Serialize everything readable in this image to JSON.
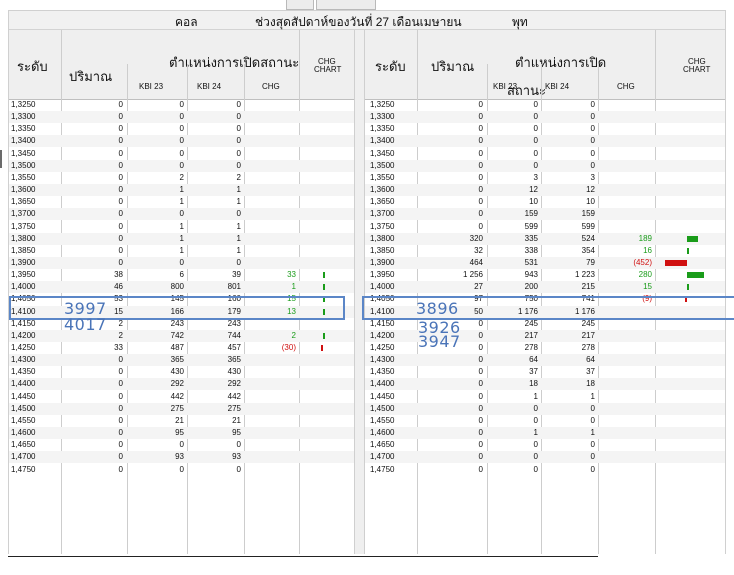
{
  "header": {
    "call": "คอล",
    "title": "ช่วงสุดสัปดาห์ของวันที่ 27 เดือนเมษายน",
    "put": "พุท"
  },
  "columns": {
    "level": "ระดับ",
    "volume": "ปริมาณ",
    "oi_call": "ตำแหน่งการเปิดสถานะ",
    "oi_put_line1": "ตำแหน่งการเปิด",
    "oi_put_line2": "สถานะ",
    "kbi23": "KBI 23",
    "kbi24": "KBI 24",
    "chg": "CHG",
    "chg_chart_1": "CHG",
    "chg_chart_2": "CHART"
  },
  "colors": {
    "positive": "#1a9c1a",
    "negative": "#d01010",
    "highlight": "#5b86c7"
  },
  "annotations": {
    "left_1": "3997",
    "left_2": "4017",
    "right_1": "3896",
    "right_2": "3926",
    "right_3": "3947"
  },
  "rows": [
    {
      "level": "1,3250",
      "c_vol": "0",
      "c_k23": "0",
      "c_k24": "0",
      "c_chg": "",
      "c_bar": 0,
      "p_vol": "0",
      "p_k23": "0",
      "p_k24": "0",
      "p_chg": "",
      "p_bar": 0
    },
    {
      "level": "1,3300",
      "c_vol": "0",
      "c_k23": "0",
      "c_k24": "0",
      "c_chg": "",
      "c_bar": 0,
      "p_vol": "0",
      "p_k23": "0",
      "p_k24": "0",
      "p_chg": "",
      "p_bar": 0
    },
    {
      "level": "1,3350",
      "c_vol": "0",
      "c_k23": "0",
      "c_k24": "0",
      "c_chg": "",
      "c_bar": 0,
      "p_vol": "0",
      "p_k23": "0",
      "p_k24": "0",
      "p_chg": "",
      "p_bar": 0
    },
    {
      "level": "1,3400",
      "c_vol": "0",
      "c_k23": "0",
      "c_k24": "0",
      "c_chg": "",
      "c_bar": 0,
      "p_vol": "0",
      "p_k23": "0",
      "p_k24": "0",
      "p_chg": "",
      "p_bar": 0
    },
    {
      "level": "1,3450",
      "c_vol": "0",
      "c_k23": "0",
      "c_k24": "0",
      "c_chg": "",
      "c_bar": 0,
      "p_vol": "0",
      "p_k23": "0",
      "p_k24": "0",
      "p_chg": "",
      "p_bar": 0
    },
    {
      "level": "1,3500",
      "c_vol": "0",
      "c_k23": "0",
      "c_k24": "0",
      "c_chg": "",
      "c_bar": 0,
      "p_vol": "0",
      "p_k23": "0",
      "p_k24": "0",
      "p_chg": "",
      "p_bar": 0
    },
    {
      "level": "1,3550",
      "c_vol": "0",
      "c_k23": "2",
      "c_k24": "2",
      "c_chg": "",
      "c_bar": 0,
      "p_vol": "0",
      "p_k23": "3",
      "p_k24": "3",
      "p_chg": "",
      "p_bar": 0
    },
    {
      "level": "1,3600",
      "c_vol": "0",
      "c_k23": "1",
      "c_k24": "1",
      "c_chg": "",
      "c_bar": 0,
      "p_vol": "0",
      "p_k23": "12",
      "p_k24": "12",
      "p_chg": "",
      "p_bar": 0
    },
    {
      "level": "1,3650",
      "c_vol": "0",
      "c_k23": "1",
      "c_k24": "1",
      "c_chg": "",
      "c_bar": 0,
      "p_vol": "0",
      "p_k23": "10",
      "p_k24": "10",
      "p_chg": "",
      "p_bar": 0
    },
    {
      "level": "1,3700",
      "c_vol": "0",
      "c_k23": "0",
      "c_k24": "0",
      "c_chg": "",
      "c_bar": 0,
      "p_vol": "0",
      "p_k23": "159",
      "p_k24": "159",
      "p_chg": "",
      "p_bar": 0
    },
    {
      "level": "1,3750",
      "c_vol": "0",
      "c_k23": "1",
      "c_k24": "1",
      "c_chg": "",
      "c_bar": 0,
      "p_vol": "0",
      "p_k23": "599",
      "p_k24": "599",
      "p_chg": "",
      "p_bar": 0
    },
    {
      "level": "1,3800",
      "c_vol": "0",
      "c_k23": "1",
      "c_k24": "1",
      "c_chg": "",
      "c_bar": 0,
      "p_vol": "320",
      "p_k23": "335",
      "p_k24": "524",
      "p_chg": "189",
      "p_bar": 189
    },
    {
      "level": "1,3850",
      "c_vol": "0",
      "c_k23": "1",
      "c_k24": "1",
      "c_chg": "",
      "c_bar": 0,
      "p_vol": "32",
      "p_k23": "338",
      "p_k24": "354",
      "p_chg": "16",
      "p_bar": 16
    },
    {
      "level": "1,3900",
      "c_vol": "0",
      "c_k23": "0",
      "c_k24": "0",
      "c_chg": "",
      "c_bar": 0,
      "p_vol": "464",
      "p_k23": "531",
      "p_k24": "79",
      "p_chg": "(452)",
      "p_bar": -452
    },
    {
      "level": "1,3950",
      "c_vol": "38",
      "c_k23": "6",
      "c_k24": "39",
      "c_chg": "33",
      "c_bar": 33,
      "p_vol": "1 256",
      "p_k23": "943",
      "p_k24": "1 223",
      "p_chg": "280",
      "p_bar": 280
    },
    {
      "level": "1,4000",
      "c_vol": "46",
      "c_k23": "800",
      "c_k24": "801",
      "c_chg": "1",
      "c_bar": 1,
      "p_vol": "27",
      "p_k23": "200",
      "p_k24": "215",
      "p_chg": "15",
      "p_bar": 15
    },
    {
      "level": "1,4050",
      "c_vol": "53",
      "c_k23": "145",
      "c_k24": "160",
      "c_chg": "15",
      "c_bar": 15,
      "p_vol": "97",
      "p_k23": "750",
      "p_k24": "741",
      "p_chg": "(9)",
      "p_bar": -9
    },
    {
      "level": "1,4100",
      "c_vol": "15",
      "c_k23": "166",
      "c_k24": "179",
      "c_chg": "13",
      "c_bar": 13,
      "p_vol": "50",
      "p_k23": "1 176",
      "p_k24": "1 176",
      "p_chg": "",
      "p_bar": 0
    },
    {
      "level": "1,4150",
      "c_vol": "2",
      "c_k23": "243",
      "c_k24": "243",
      "c_chg": "",
      "c_bar": 0,
      "p_vol": "0",
      "p_k23": "245",
      "p_k24": "245",
      "p_chg": "",
      "p_bar": 0
    },
    {
      "level": "1,4200",
      "c_vol": "2",
      "c_k23": "742",
      "c_k24": "744",
      "c_chg": "2",
      "c_bar": 2,
      "p_vol": "0",
      "p_k23": "217",
      "p_k24": "217",
      "p_chg": "",
      "p_bar": 0
    },
    {
      "level": "1,4250",
      "c_vol": "33",
      "c_k23": "487",
      "c_k24": "457",
      "c_chg": "(30)",
      "c_bar": -30,
      "p_vol": "0",
      "p_k23": "278",
      "p_k24": "278",
      "p_chg": "",
      "p_bar": 0
    },
    {
      "level": "1,4300",
      "c_vol": "0",
      "c_k23": "365",
      "c_k24": "365",
      "c_chg": "",
      "c_bar": 0,
      "p_vol": "0",
      "p_k23": "64",
      "p_k24": "64",
      "p_chg": "",
      "p_bar": 0
    },
    {
      "level": "1,4350",
      "c_vol": "0",
      "c_k23": "430",
      "c_k24": "430",
      "c_chg": "",
      "c_bar": 0,
      "p_vol": "0",
      "p_k23": "37",
      "p_k24": "37",
      "p_chg": "",
      "p_bar": 0
    },
    {
      "level": "1,4400",
      "c_vol": "0",
      "c_k23": "292",
      "c_k24": "292",
      "c_chg": "",
      "c_bar": 0,
      "p_vol": "0",
      "p_k23": "18",
      "p_k24": "18",
      "p_chg": "",
      "p_bar": 0
    },
    {
      "level": "1,4450",
      "c_vol": "0",
      "c_k23": "442",
      "c_k24": "442",
      "c_chg": "",
      "c_bar": 0,
      "p_vol": "0",
      "p_k23": "1",
      "p_k24": "1",
      "p_chg": "",
      "p_bar": 0
    },
    {
      "level": "1,4500",
      "c_vol": "0",
      "c_k23": "275",
      "c_k24": "275",
      "c_chg": "",
      "c_bar": 0,
      "p_vol": "0",
      "p_k23": "0",
      "p_k24": "0",
      "p_chg": "",
      "p_bar": 0
    },
    {
      "level": "1,4550",
      "c_vol": "0",
      "c_k23": "21",
      "c_k24": "21",
      "c_chg": "",
      "c_bar": 0,
      "p_vol": "0",
      "p_k23": "0",
      "p_k24": "0",
      "p_chg": "",
      "p_bar": 0
    },
    {
      "level": "1,4600",
      "c_vol": "0",
      "c_k23": "95",
      "c_k24": "95",
      "c_chg": "",
      "c_bar": 0,
      "p_vol": "0",
      "p_k23": "1",
      "p_k24": "1",
      "p_chg": "",
      "p_bar": 0
    },
    {
      "level": "1,4650",
      "c_vol": "0",
      "c_k23": "0",
      "c_k24": "0",
      "c_chg": "",
      "c_bar": 0,
      "p_vol": "0",
      "p_k23": "0",
      "p_k24": "0",
      "p_chg": "",
      "p_bar": 0
    },
    {
      "level": "1,4700",
      "c_vol": "0",
      "c_k23": "93",
      "c_k24": "93",
      "c_chg": "",
      "c_bar": 0,
      "p_vol": "0",
      "p_k23": "0",
      "p_k24": "0",
      "p_chg": "",
      "p_bar": 0
    },
    {
      "level": "1,4750",
      "c_vol": "0",
      "c_k23": "0",
      "c_k24": "0",
      "c_chg": "",
      "c_bar": 0,
      "p_vol": "0",
      "p_k23": "0",
      "p_k24": "0",
      "p_chg": "",
      "p_bar": 0
    }
  ]
}
